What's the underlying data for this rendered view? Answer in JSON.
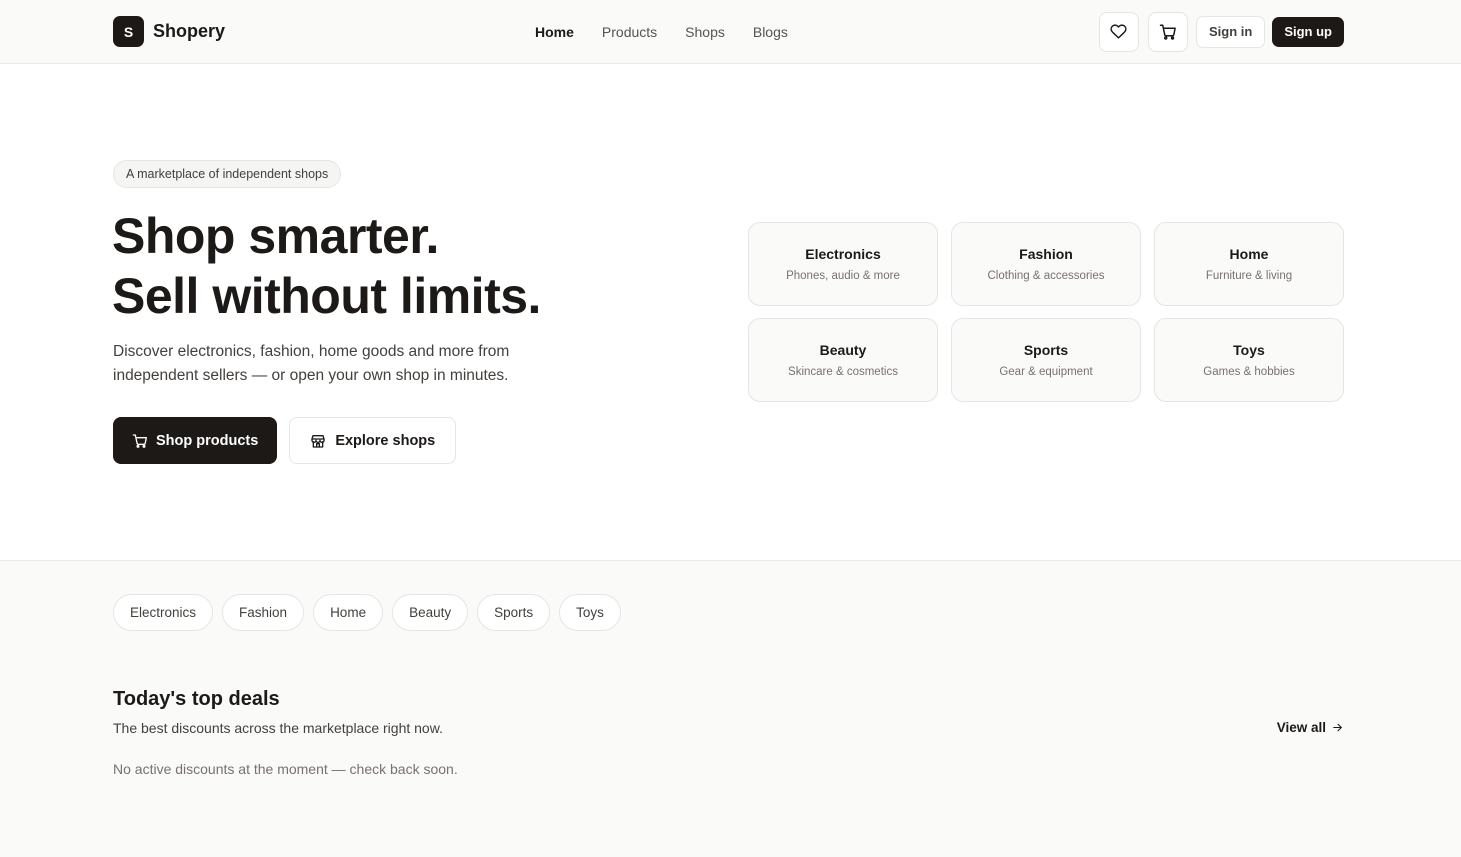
{
  "header": {
    "logo_letter": "S",
    "brand": "Shopery",
    "nav": [
      "Home",
      "Products",
      "Shops",
      "Blogs"
    ],
    "sign_in": "Sign in",
    "sign_up": "Sign up"
  },
  "hero": {
    "eyebrow": "A marketplace of independent shops",
    "headline_line1": "Shop smarter.",
    "headline_line2": "Sell without limits.",
    "subtitle": "Discover electronics, fashion, home goods and more from independent sellers — or open your own shop in minutes.",
    "primary_cta": "Shop products",
    "secondary_cta": "Explore shops",
    "categories": [
      {
        "title": "Electronics",
        "desc": "Phones, audio & more"
      },
      {
        "title": "Fashion",
        "desc": "Clothing & accessories"
      },
      {
        "title": "Home",
        "desc": "Furniture & living"
      },
      {
        "title": "Beauty",
        "desc": "Skincare & cosmetics"
      },
      {
        "title": "Sports",
        "desc": "Gear & equipment"
      },
      {
        "title": "Toys",
        "desc": "Games & hobbies"
      }
    ]
  },
  "chips": [
    "Electronics",
    "Fashion",
    "Home",
    "Beauty",
    "Sports",
    "Toys"
  ],
  "deals": {
    "title": "Today's top deals",
    "subtitle": "The best discounts across the marketplace right now.",
    "view_all": "View all",
    "empty": "No active discounts at the moment — check back soon."
  }
}
